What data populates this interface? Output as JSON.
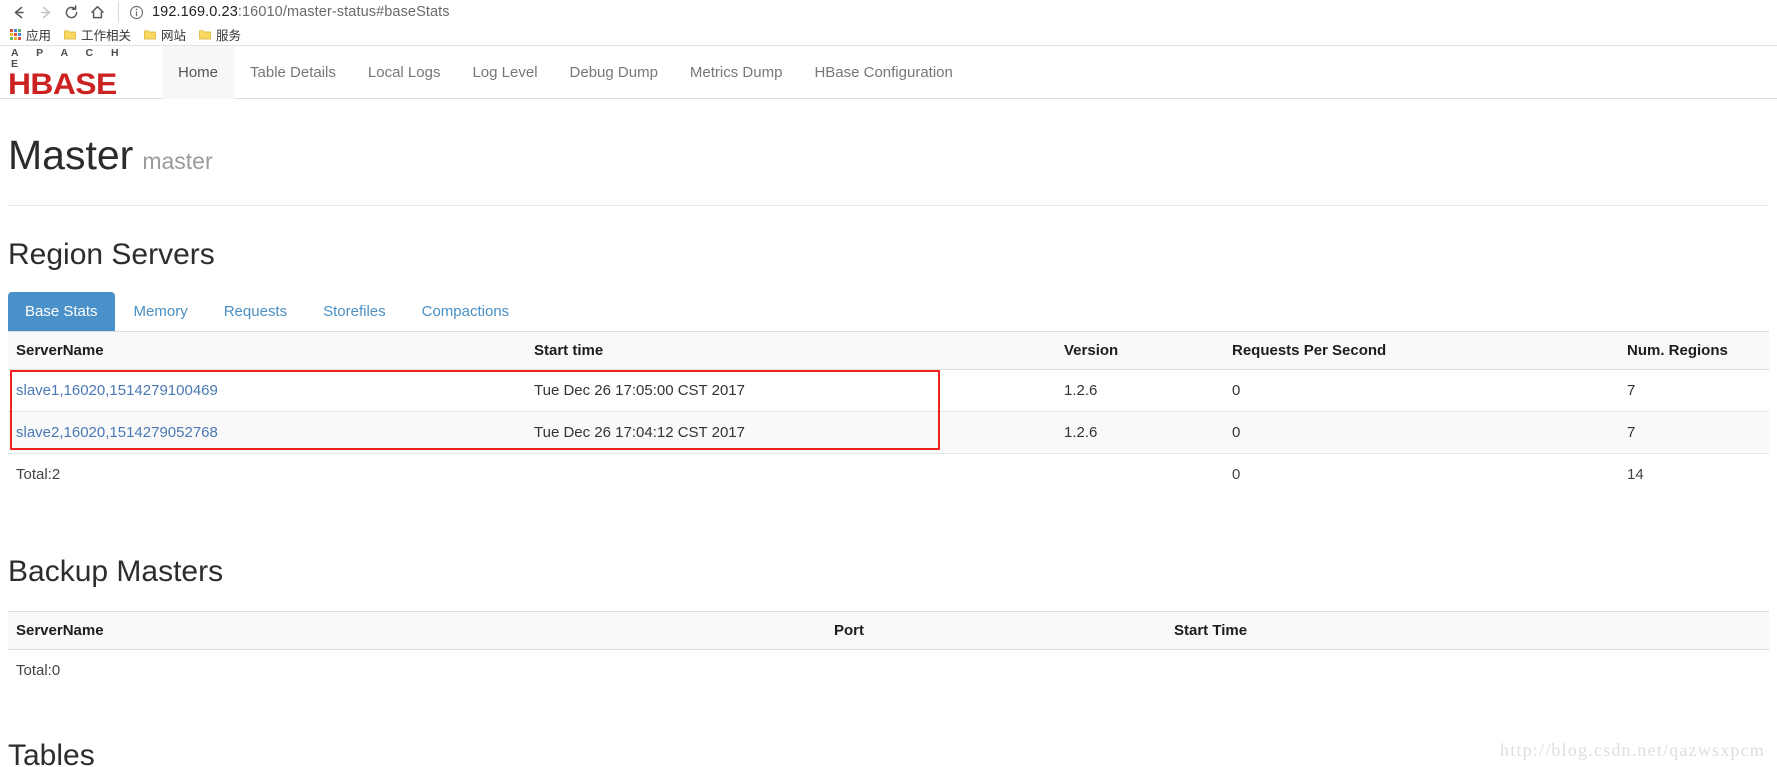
{
  "browser": {
    "back_icon": "arrow-left-icon",
    "forward_icon": "arrow-right-icon",
    "reload_icon": "reload-icon",
    "home_icon": "home-icon",
    "info_icon": "page-info-icon",
    "url_host": "192.169.0.23",
    "url_rest": ":16010/master-status#baseStats",
    "url_full": "192.169.0.23:16010/master-status#baseStats",
    "bookmarks": [
      {
        "label": "应用",
        "icon": "apps-grid-icon"
      },
      {
        "label": "工作相关",
        "icon": "folder-icon"
      },
      {
        "label": "网站",
        "icon": "folder-icon"
      },
      {
        "label": "服务",
        "icon": "folder-icon"
      }
    ]
  },
  "header": {
    "brand_top": "A P A C H E",
    "brand_main": "HBASE",
    "nav": [
      {
        "label": "Home",
        "active": true
      },
      {
        "label": "Table Details",
        "active": false
      },
      {
        "label": "Local Logs",
        "active": false
      },
      {
        "label": "Log Level",
        "active": false
      },
      {
        "label": "Debug Dump",
        "active": false
      },
      {
        "label": "Metrics Dump",
        "active": false
      },
      {
        "label": "HBase Configuration",
        "active": false
      }
    ]
  },
  "page": {
    "title": "Master",
    "subtitle": "master"
  },
  "region_servers": {
    "heading": "Region Servers",
    "tabs": [
      {
        "label": "Base Stats",
        "active": true
      },
      {
        "label": "Memory",
        "active": false
      },
      {
        "label": "Requests",
        "active": false
      },
      {
        "label": "Storefiles",
        "active": false
      },
      {
        "label": "Compactions",
        "active": false
      }
    ],
    "columns": [
      "ServerName",
      "Start time",
      "Version",
      "Requests Per Second",
      "Num. Regions"
    ],
    "rows": [
      {
        "server_name": "slave1,16020,1514279100469",
        "start_time": "Tue Dec 26 17:05:00 CST 2017",
        "version": "1.2.6",
        "requests_per_second": "0",
        "num_regions": "7"
      },
      {
        "server_name": "slave2,16020,1514279052768",
        "start_time": "Tue Dec 26 17:04:12 CST 2017",
        "version": "1.2.6",
        "requests_per_second": "0",
        "num_regions": "7"
      }
    ],
    "total_label": "Total:2",
    "total_requests_per_second": "0",
    "total_num_regions": "14",
    "highlight_color": "#ee2222"
  },
  "backup_masters": {
    "heading": "Backup Masters",
    "columns": [
      "ServerName",
      "Port",
      "Start Time"
    ],
    "rows": [],
    "total_label": "Total:0"
  },
  "tables_section": {
    "heading": "Tables"
  },
  "watermark": "http://blog.csdn.net/qazwsxpcm",
  "colors": {
    "brand_red": "#cc2222",
    "tab_active_bg": "#4a90c9",
    "link_blue": "#4a78b5",
    "highlight_red": "#ee2222"
  }
}
